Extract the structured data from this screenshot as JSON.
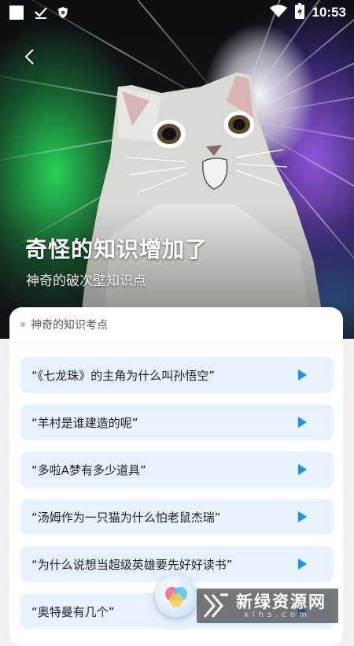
{
  "status_bar": {
    "time": "10:53",
    "icons": [
      "square-icon",
      "check-icon",
      "shield-icon",
      "wifi-icon",
      "battery-icon"
    ]
  },
  "hero": {
    "title": "奇怪的知识增加了",
    "subtitle": "神奇的破次壁知识点"
  },
  "card": {
    "title": "神奇的知识考点",
    "questions": [
      {
        "text": "“《七龙珠》的主角为什么叫孙悟空”"
      },
      {
        "text": "“羊村是谁建造的呢”"
      },
      {
        "text": "“多啦A梦有多少道具”"
      },
      {
        "text": "“汤姆作为一只猫为什么怕老鼠杰瑞”"
      },
      {
        "text": "“为什么说想当超级英雄要先好好读书”"
      },
      {
        "text": "“奥特曼有几个”"
      }
    ]
  },
  "watermark": {
    "text": "新绿资源网",
    "sub": "xlhs.com"
  },
  "colors": {
    "accent": "#1f8ff5",
    "question_bg": "#e5f1fd",
    "dot": "#f3a7a7"
  }
}
